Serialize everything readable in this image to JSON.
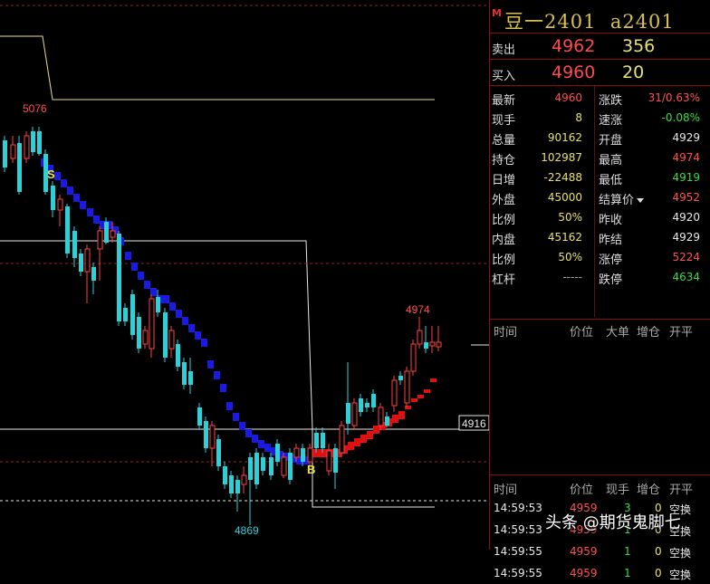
{
  "header": {
    "badge": "M",
    "contract_name": "豆一2401",
    "contract_code": "a2401"
  },
  "quotes": [
    {
      "label": "卖出",
      "price": "4962",
      "volume": "356"
    },
    {
      "label": "买入",
      "price": "4960",
      "volume": "20"
    }
  ],
  "stats": [
    {
      "l1": "最新",
      "v1": "4960",
      "c1": "#ff5050",
      "l2": "涨跌",
      "v2": "31/0.63%",
      "c2": "#ff5050"
    },
    {
      "l1": "现手",
      "v1": "8",
      "c1": "#e8e070",
      "l2": "速涨",
      "v2": "-0.08%",
      "c2": "#3cdc3c"
    },
    {
      "l1": "总量",
      "v1": "90162",
      "c1": "#e8e070",
      "l2": "开盘",
      "v2": "4929",
      "c2": "#e8e8e8"
    },
    {
      "l1": "持仓",
      "v1": "102987",
      "c1": "#e8e070",
      "l2": "最高",
      "v2": "4974",
      "c2": "#ff5050"
    },
    {
      "l1": "日增",
      "v1": "-22488",
      "c1": "#e8e070",
      "l2": "最低",
      "v2": "4919",
      "c2": "#3cdc3c"
    },
    {
      "l1": "外盘",
      "v1": "45000",
      "c1": "#e8e070",
      "l2": "结算价",
      "v2": "4952",
      "c2": "#ff5050"
    },
    {
      "l1": "比例",
      "v1": "50%",
      "c1": "#e8e070",
      "l2": "昨收",
      "v2": "4920",
      "c2": "#e8e8e8"
    },
    {
      "l1": "内盘",
      "v1": "45162",
      "c1": "#e8e070",
      "l2": "昨结",
      "v2": "4929",
      "c2": "#e8e8e8"
    },
    {
      "l1": "比例",
      "v1": "50%",
      "c1": "#e8e070",
      "l2": "涨停",
      "v2": "5224",
      "c2": "#ff5050"
    },
    {
      "l1": "杠杆",
      "v1": "-----",
      "c1": "#aaaaaa",
      "l2": "跌停",
      "v2": "4634",
      "c2": "#3cdc3c"
    }
  ],
  "bigorder_headers": {
    "time": "时间",
    "price": "价位",
    "big": "大单",
    "oi": "增仓",
    "oc": "开平"
  },
  "tick_headers": {
    "time": "时间",
    "price": "价位",
    "vol": "现手",
    "oi": "增仓",
    "oc": "开平"
  },
  "ticks": [
    {
      "time": "14:59:53",
      "price": "4959",
      "vol": "3",
      "oi": "0",
      "oc": "空换"
    },
    {
      "time": "14:59:53",
      "price": "4959",
      "vol": "1",
      "oi": "0",
      "oc": "空换"
    },
    {
      "time": "14:59:55",
      "price": "4959",
      "vol": "1",
      "oi": "0",
      "oc": "空换"
    },
    {
      "time": "14:59:55",
      "price": "4959",
      "vol": "1",
      "oi": "0",
      "oc": "空换"
    }
  ],
  "chart_labels": {
    "high_label": "5076",
    "low_label": "4869",
    "recent_high_label": "4974",
    "price_tag": "4916",
    "sell_signal": "S",
    "buy_signal": "B"
  },
  "watermark": "头条 @期货鬼脚七",
  "colors": {
    "up": "#ff4040",
    "down": "#2ed0d8",
    "red_dots": "#e01010",
    "blue_dots": "#1a1ae0",
    "panel_border": "#8a1010"
  }
}
